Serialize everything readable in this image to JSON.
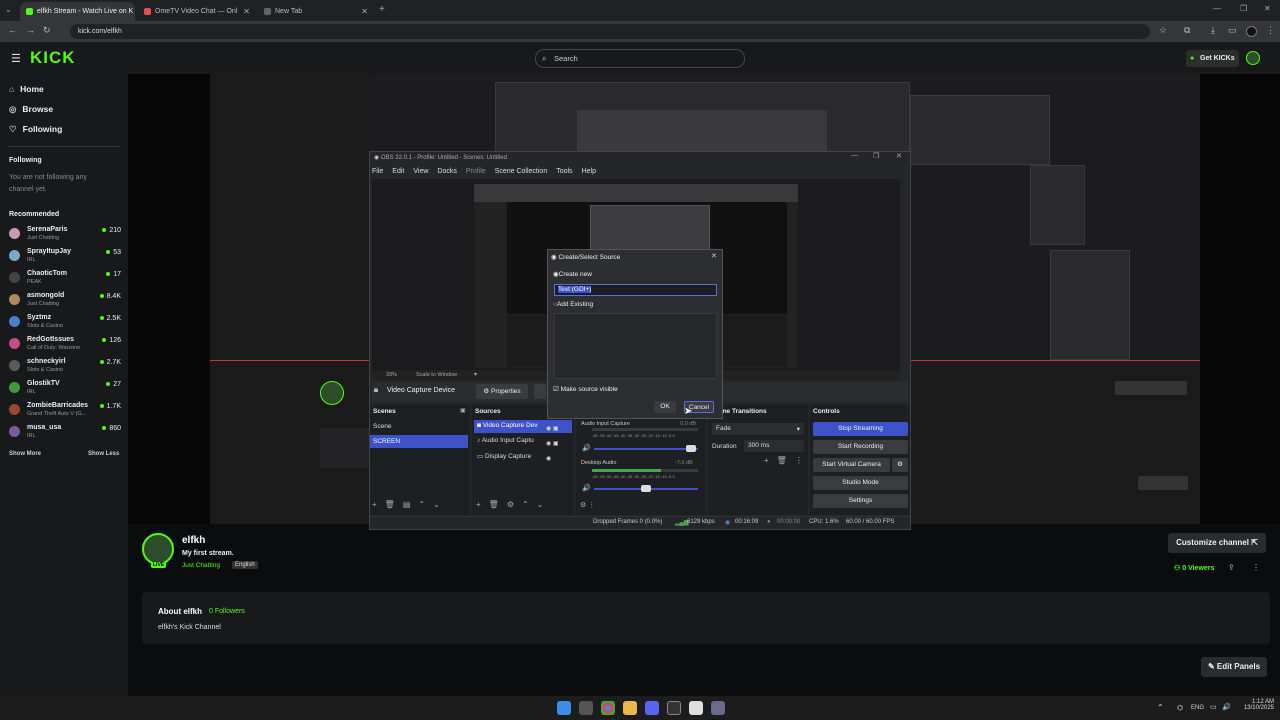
{
  "browser": {
    "tabs": [
      {
        "label": "elfkh Stream - Watch Live on K",
        "color": "#53fc18"
      },
      {
        "label": "OmeTV Video Chat — Onl",
        "color": "#e34f4f"
      },
      {
        "label": "New Tab",
        "color": "#5f6368"
      }
    ],
    "url": "kick.com/elfkh"
  },
  "kick": {
    "logo": "KICK",
    "search_placeholder": "Search",
    "get_kicks": "Get KICKs",
    "nav": [
      "Home",
      "Browse",
      "Following"
    ],
    "following_title": "Following",
    "following_empty": "You are not following any channel yet.",
    "recommended_title": "Recommended",
    "recommended": [
      {
        "name": "SerenaParis",
        "category": "Just Chatting",
        "viewers": "210",
        "color": "#c89ab5"
      },
      {
        "name": "SprayItupJay",
        "category": "IRL",
        "viewers": "53",
        "color": "#7aa8c9"
      },
      {
        "name": "ChaoticTom",
        "category": "PEAK",
        "viewers": "17",
        "color": "#444"
      },
      {
        "name": "asmongold",
        "category": "Just Chatting",
        "viewers": "8.4K",
        "color": "#b08a5e"
      },
      {
        "name": "Syztmz",
        "category": "Slots & Casino",
        "viewers": "2.5K",
        "color": "#4a7fc9"
      },
      {
        "name": "RedGotIssues",
        "category": "Call of Duty: Warzone",
        "viewers": "126",
        "color": "#c94a8a"
      },
      {
        "name": "schneckyirl",
        "category": "Slots & Casino",
        "viewers": "2.7K",
        "color": "#5a5a5a"
      },
      {
        "name": "GlostikTV",
        "category": "IRL",
        "viewers": "27",
        "color": "#3d9a3d"
      },
      {
        "name": "ZombieBarricades",
        "category": "Grand Theft Auto V (G...",
        "viewers": "1.7K",
        "color": "#9a4a2a"
      },
      {
        "name": "musa_usa",
        "category": "IRL",
        "viewers": "860",
        "color": "#7a5a9a"
      }
    ],
    "show_more": "Show More",
    "show_less": "Show Less",
    "channel": {
      "name": "elfkh",
      "title": "My first stream.",
      "category": "Just Chatting",
      "language": "English",
      "customize": "Customize channel",
      "viewers": "0 Viewers",
      "about_title": "About elfkh",
      "followers": "0 Followers",
      "about_text": "elfkh's Kick Channel",
      "edit_panels": "Edit Panels"
    }
  },
  "obs": {
    "title": "OBS 32.0.1 - Profile: Untitled - Scenes: Untitled",
    "menu": [
      "File",
      "Edit",
      "View",
      "Docks",
      "Profile",
      "Scene Collection",
      "Tools",
      "Help"
    ],
    "zoom": "33%",
    "scale": "Scale to Window",
    "source_selected": "Video Capture Device",
    "properties": "Properties",
    "docks": {
      "scenes": "Scenes",
      "sources": "Sources",
      "transitions": "Scene Transitions",
      "controls": "Controls"
    },
    "scenes": [
      "Scene",
      "SCREEN"
    ],
    "sources": [
      "Video Capture Dev",
      "Audio Input Captu",
      "Display Capture"
    ],
    "mixer": [
      {
        "name": "Audio Input Capture",
        "db": "0.0 dB"
      },
      {
        "name": "Desktop Audio",
        "db": "-7.6 dB"
      }
    ],
    "meter_ticks": "-60 -55 -50 -45 -40 -35 -30 -25 -20 -15 -10 -5 0",
    "transition": "Fade",
    "duration_label": "Duration",
    "duration": "300 ms",
    "controls": [
      "Stop Streaming",
      "Start Recording",
      "Start Virtual Camera",
      "Studio Mode",
      "Settings"
    ],
    "status": {
      "dropped": "Dropped Frames 0 (0.0%)",
      "bitrate": "6129 kbps",
      "live_time": "00:16:09",
      "rec_time": "00:00:00",
      "cpu": "CPU: 1.6%",
      "fps": "60.00 / 60.00 FPS"
    },
    "dialog": {
      "title": "Create/Select Source",
      "create_new": "Create new",
      "name_value": "Text (GDI+)",
      "add_existing": "Add Existing",
      "make_visible": "Make source visible",
      "ok": "OK",
      "cancel": "Cancel"
    }
  },
  "taskbar": {
    "lang": "ENG",
    "time": "1:12 AM",
    "date": "13/10/2025"
  }
}
